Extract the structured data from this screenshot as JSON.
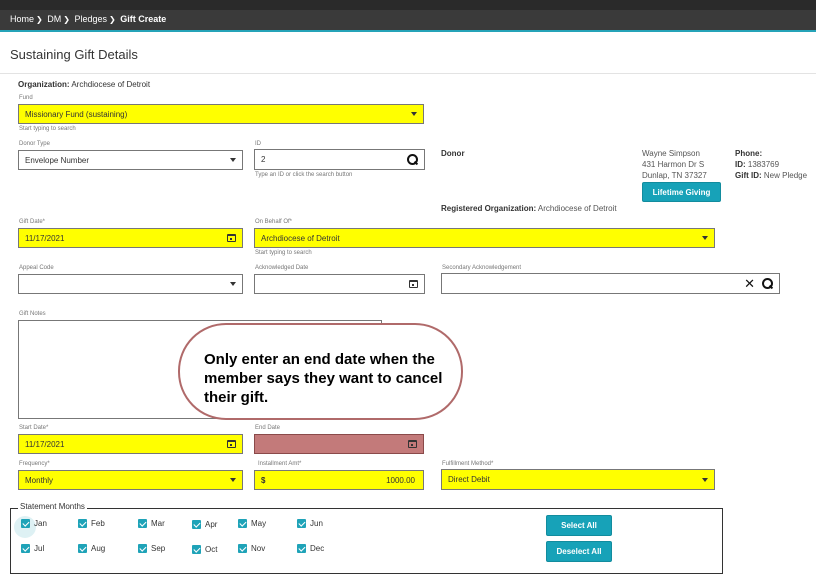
{
  "breadcrumb": {
    "home": "Home",
    "dm": "DM",
    "pledges": "Pledges",
    "current": "Gift Create"
  },
  "page_title": "Sustaining Gift Details",
  "organization": {
    "label": "Organization:",
    "value": "Archdiocese of Detroit"
  },
  "fund": {
    "label": "Fund",
    "value": "Missionary Fund (sustaining)",
    "hint": "Start typing to search"
  },
  "donor_type": {
    "label": "Donor Type",
    "value": "Envelope Number"
  },
  "id_field": {
    "label": "ID",
    "value": "2",
    "hint": "Type an ID or click the search button"
  },
  "donor": {
    "heading": "Donor",
    "name": "Wayne Simpson",
    "address1": "431 Harmon Dr S",
    "address2": "Dunlap, TN 37327",
    "phone_label": "Phone:",
    "id_label": "ID:",
    "id_value": "1383769",
    "gift_id_label": "Gift ID:",
    "gift_id_value": "New Pledge",
    "lifetime_button": "Lifetime Giving",
    "registered_org_label": "Registered Organization:",
    "registered_org_value": "Archdiocese of Detroit"
  },
  "gift_date": {
    "label": "Gift Date*",
    "value": "11/17/2021"
  },
  "on_behalf_of": {
    "label": "On Behalf Of*",
    "value": "Archdiocese of Detroit",
    "hint": "Start typing to search"
  },
  "appeal_code": {
    "label": "Appeal Code",
    "value": ""
  },
  "acknowledged_date": {
    "label": "Acknowledged Date",
    "value": ""
  },
  "secondary_ack": {
    "label": "Secondary Acknowledgement",
    "value": ""
  },
  "gift_notes": {
    "label": "Gift Notes",
    "value": ""
  },
  "callout": "Only enter an end date when the member says they want to cancel their gift.",
  "start_date": {
    "label": "Start Date*",
    "value": "11/17/2021"
  },
  "end_date": {
    "label": "End Date",
    "value": ""
  },
  "frequency": {
    "label": "Frequency*",
    "value": "Monthly"
  },
  "installment": {
    "label": "Installment Amt*",
    "currency": "$",
    "value": "1000.00"
  },
  "fulfillment": {
    "label": "Fulfillment Method*",
    "value": "Direct Debit"
  },
  "statement_months": {
    "legend": "Statement Months",
    "months": [
      "Jan",
      "Feb",
      "Mar",
      "Apr",
      "May",
      "Jun",
      "Jul",
      "Aug",
      "Sep",
      "Oct",
      "Nov",
      "Dec"
    ],
    "select_all": "Select All",
    "deselect_all": "Deselect All"
  },
  "colors": {
    "accent": "#17a2b8",
    "highlight": "#ffff00",
    "end_date_fill": "#c37a7a",
    "callout_border": "#b06a6a"
  }
}
